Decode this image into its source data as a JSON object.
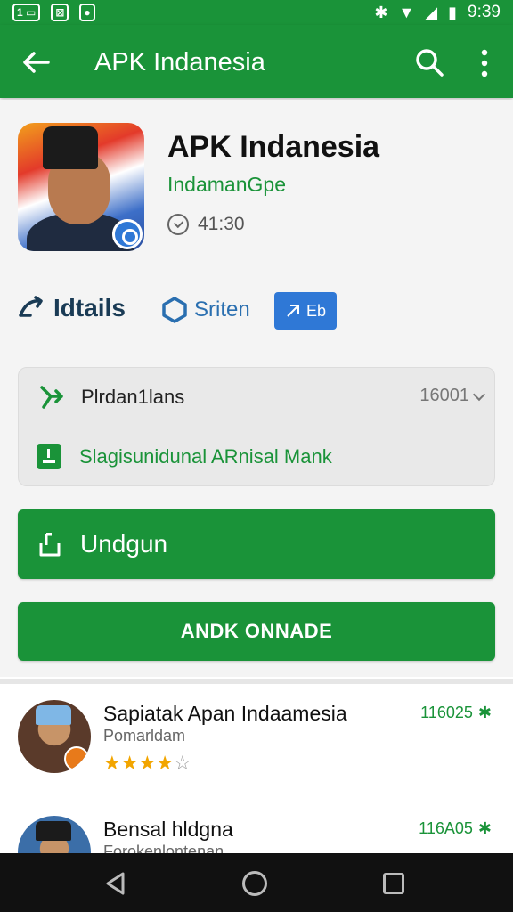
{
  "status_bar": {
    "left_badges": [
      "1",
      "⊠",
      "●"
    ],
    "time": "9:39",
    "icons": [
      "bluetooth-icon",
      "wifi-icon",
      "signal-icon",
      "battery-icon"
    ]
  },
  "app_bar": {
    "title": "APK Indanesia",
    "icons": [
      "back-arrow-icon",
      "search-icon",
      "more-vert-icon"
    ],
    "color": "#1a9339"
  },
  "app": {
    "title": "APK Indanesia",
    "developer": "IndamanGpe",
    "meta": "41:30"
  },
  "chips": {
    "details": "Idtails",
    "sitem": "Sriten",
    "button": "Eb"
  },
  "info_box": {
    "row1_label": "Plrdan​1lans",
    "row1_value": "16001",
    "row2_text": "Slagisunidunal ARnisal Mank"
  },
  "buttons": {
    "download": "Undgun",
    "secondary": "ANDK ONNADE"
  },
  "list": [
    {
      "title": "Sapiatak Apan Indaamesia",
      "subtitle": "Pomarldam",
      "count": "116025",
      "rating": 4
    },
    {
      "title": "Bensal hldgna",
      "subtitle": "Forokenlontenan",
      "count": "116A05",
      "rating": 0
    }
  ],
  "colors": {
    "primary_green": "#1a9339",
    "accent_blue": "#2f78d6",
    "star": "#f2a500"
  }
}
